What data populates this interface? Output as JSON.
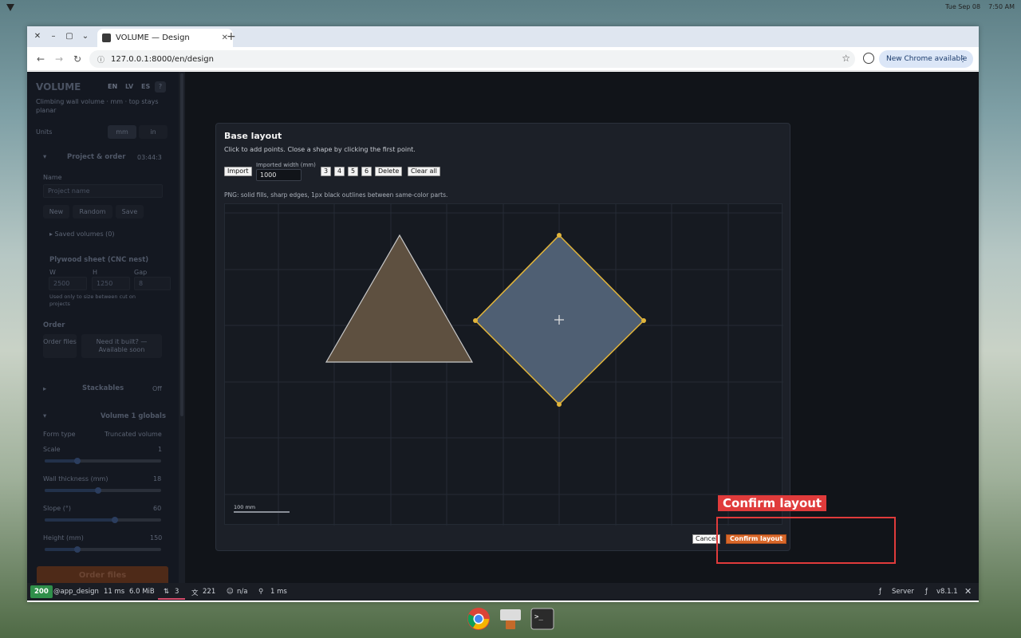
{
  "desktop": {
    "clock_date": "Tue Sep 08",
    "clock_time": "7:50 AM"
  },
  "browser": {
    "tab_title": "VOLUME — Design",
    "url": "127.0.0.1:8000/en/design",
    "update_label": "New Chrome available"
  },
  "sidebar": {
    "app_title": "VOLUME",
    "lang_en": "EN",
    "lang_lv": "LV",
    "lang_es": "ES",
    "help": "?",
    "subtitle": "Climbing wall volume · mm · top stays planar",
    "units_label": "Units",
    "units_mm": "mm",
    "units_in": "in",
    "project_section": "Project & order",
    "project_id": "03:44:3",
    "name_label": "Name",
    "name_placeholder": "Project name",
    "new_btn": "New",
    "random_btn": "Random",
    "save_btn": "Save",
    "saved_volumes": "▸ Saved volumes (0)",
    "plywood_title": "Plywood sheet (CNC nest)",
    "w_label": "W",
    "h_label": "H",
    "gap_label": "Gap",
    "w_value": "2500",
    "h_value": "1250",
    "gap_value": "8",
    "plywood_hint": "Used only to size between cut on projects",
    "order_section": "Order",
    "order_files_small": "Order files",
    "need_built": "Need it built? — Available soon",
    "stackables": "Stackables",
    "stackables_state": "Off",
    "volume_globals": "Volume 1 globals",
    "form_type_label": "Form type",
    "form_type_value": "Truncated volume",
    "scale_label": "Scale",
    "scale_value": "1",
    "wall_label": "Wall thickness (mm)",
    "wall_value": "18",
    "slope_label": "Slope (°)",
    "slope_value": "60",
    "height_label": "Height (mm)",
    "height_value": "150",
    "order_files_btn": "Order files",
    "sliders": [
      {
        "name": "scale",
        "fraction": 0.28
      },
      {
        "name": "wall",
        "fraction": 0.46
      },
      {
        "name": "slope",
        "fraction": 0.6
      },
      {
        "name": "height",
        "fraction": 0.28
      }
    ]
  },
  "modal": {
    "title": "Base layout",
    "hint": "Click to add points. Close a shape by clicking the first point.",
    "import_btn": "Import",
    "width_label": "Imported width (mm)",
    "width_value": "1000",
    "sides_3": "3",
    "sides_4": "4",
    "sides_5": "5",
    "sides_6": "6",
    "delete_btn": "Delete",
    "clear_btn": "Clear all",
    "png_hint": "PNG: solid fills, sharp edges, 1px black outlines between same-color parts.",
    "scale_label": "100 mm",
    "cancel_btn": "Cancel",
    "confirm_btn": "Confirm layout"
  },
  "shapes": {
    "triangle_fill": "#5e5040",
    "diamond_fill": "#4f5f73",
    "selected_outline": "#e2b53a"
  },
  "statusbar": {
    "code": "200",
    "route": "@app_design",
    "time": "11 ms",
    "memory": "6.0 MiB",
    "requests": "3",
    "translations": "221",
    "user": "n/a",
    "perf": "1 ms",
    "server": "Server",
    "version": "v8.1.1"
  },
  "annotation": {
    "label": "Confirm layout"
  }
}
